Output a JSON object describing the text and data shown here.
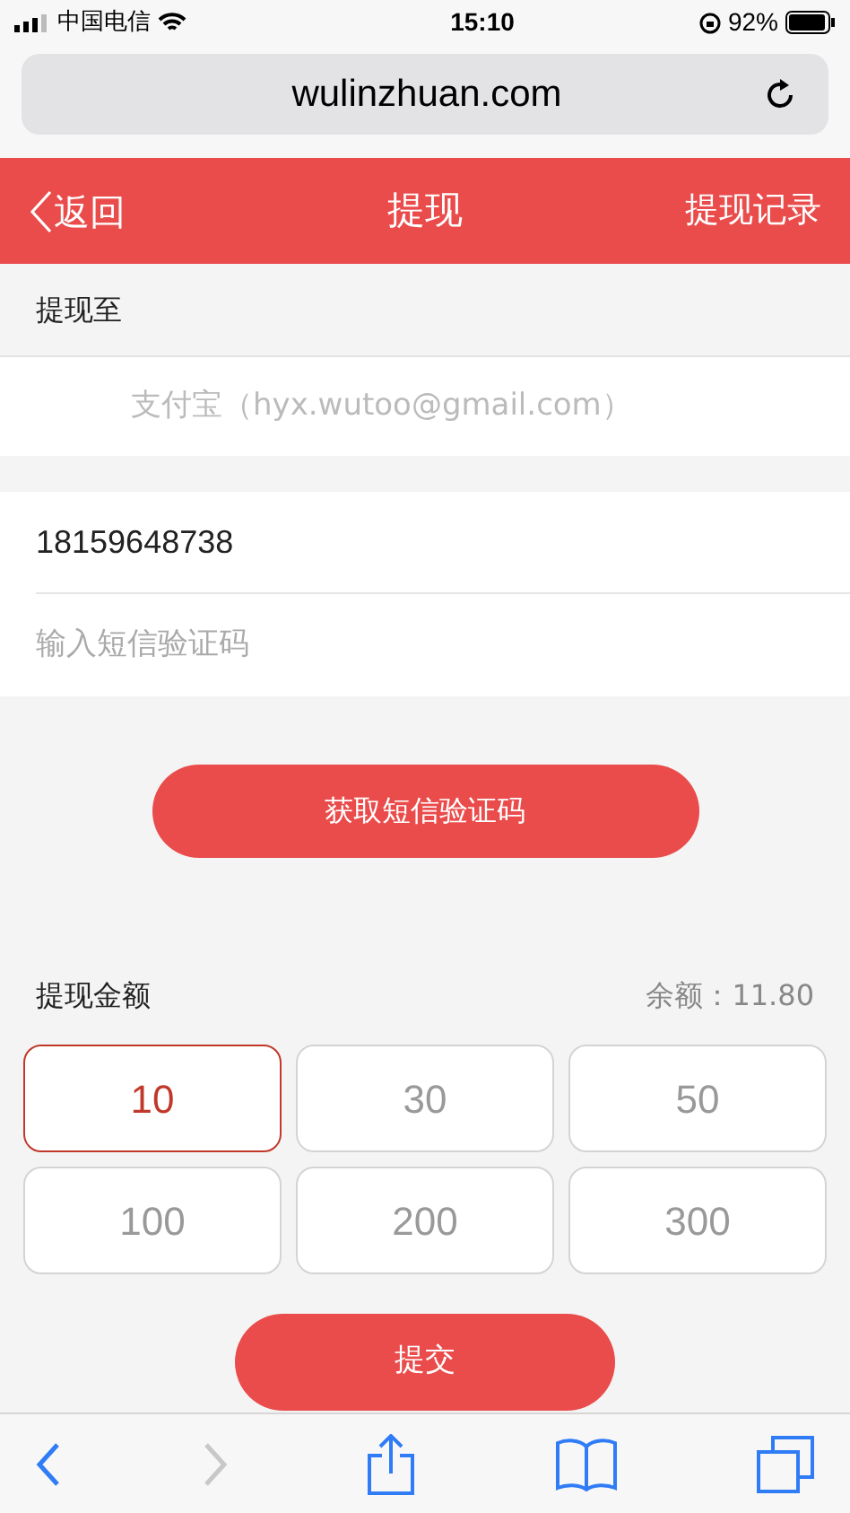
{
  "status_bar": {
    "carrier": "中国电信",
    "time": "15:10",
    "battery": "92%"
  },
  "browser": {
    "url": "wulinzhuan.com"
  },
  "header": {
    "back": "返回",
    "title": "提现",
    "action": "提现记录"
  },
  "withdraw_to": {
    "label": "提现至",
    "account": "支付宝（hyx.wutoo@gmail.com）"
  },
  "phone_field": {
    "value": "18159648738"
  },
  "code_field": {
    "placeholder": "输入短信验证码"
  },
  "get_code_button": "获取短信验证码",
  "amount": {
    "label": "提现金额",
    "balance": "余额：11.80",
    "options": [
      {
        "label": "10",
        "selected": true
      },
      {
        "label": "30",
        "selected": false
      },
      {
        "label": "50",
        "selected": false
      },
      {
        "label": "100",
        "selected": false
      },
      {
        "label": "200",
        "selected": false
      },
      {
        "label": "300",
        "selected": false
      }
    ]
  },
  "submit_button": "提交",
  "toolbar": {
    "back_disabled": false,
    "forward_disabled": true
  }
}
